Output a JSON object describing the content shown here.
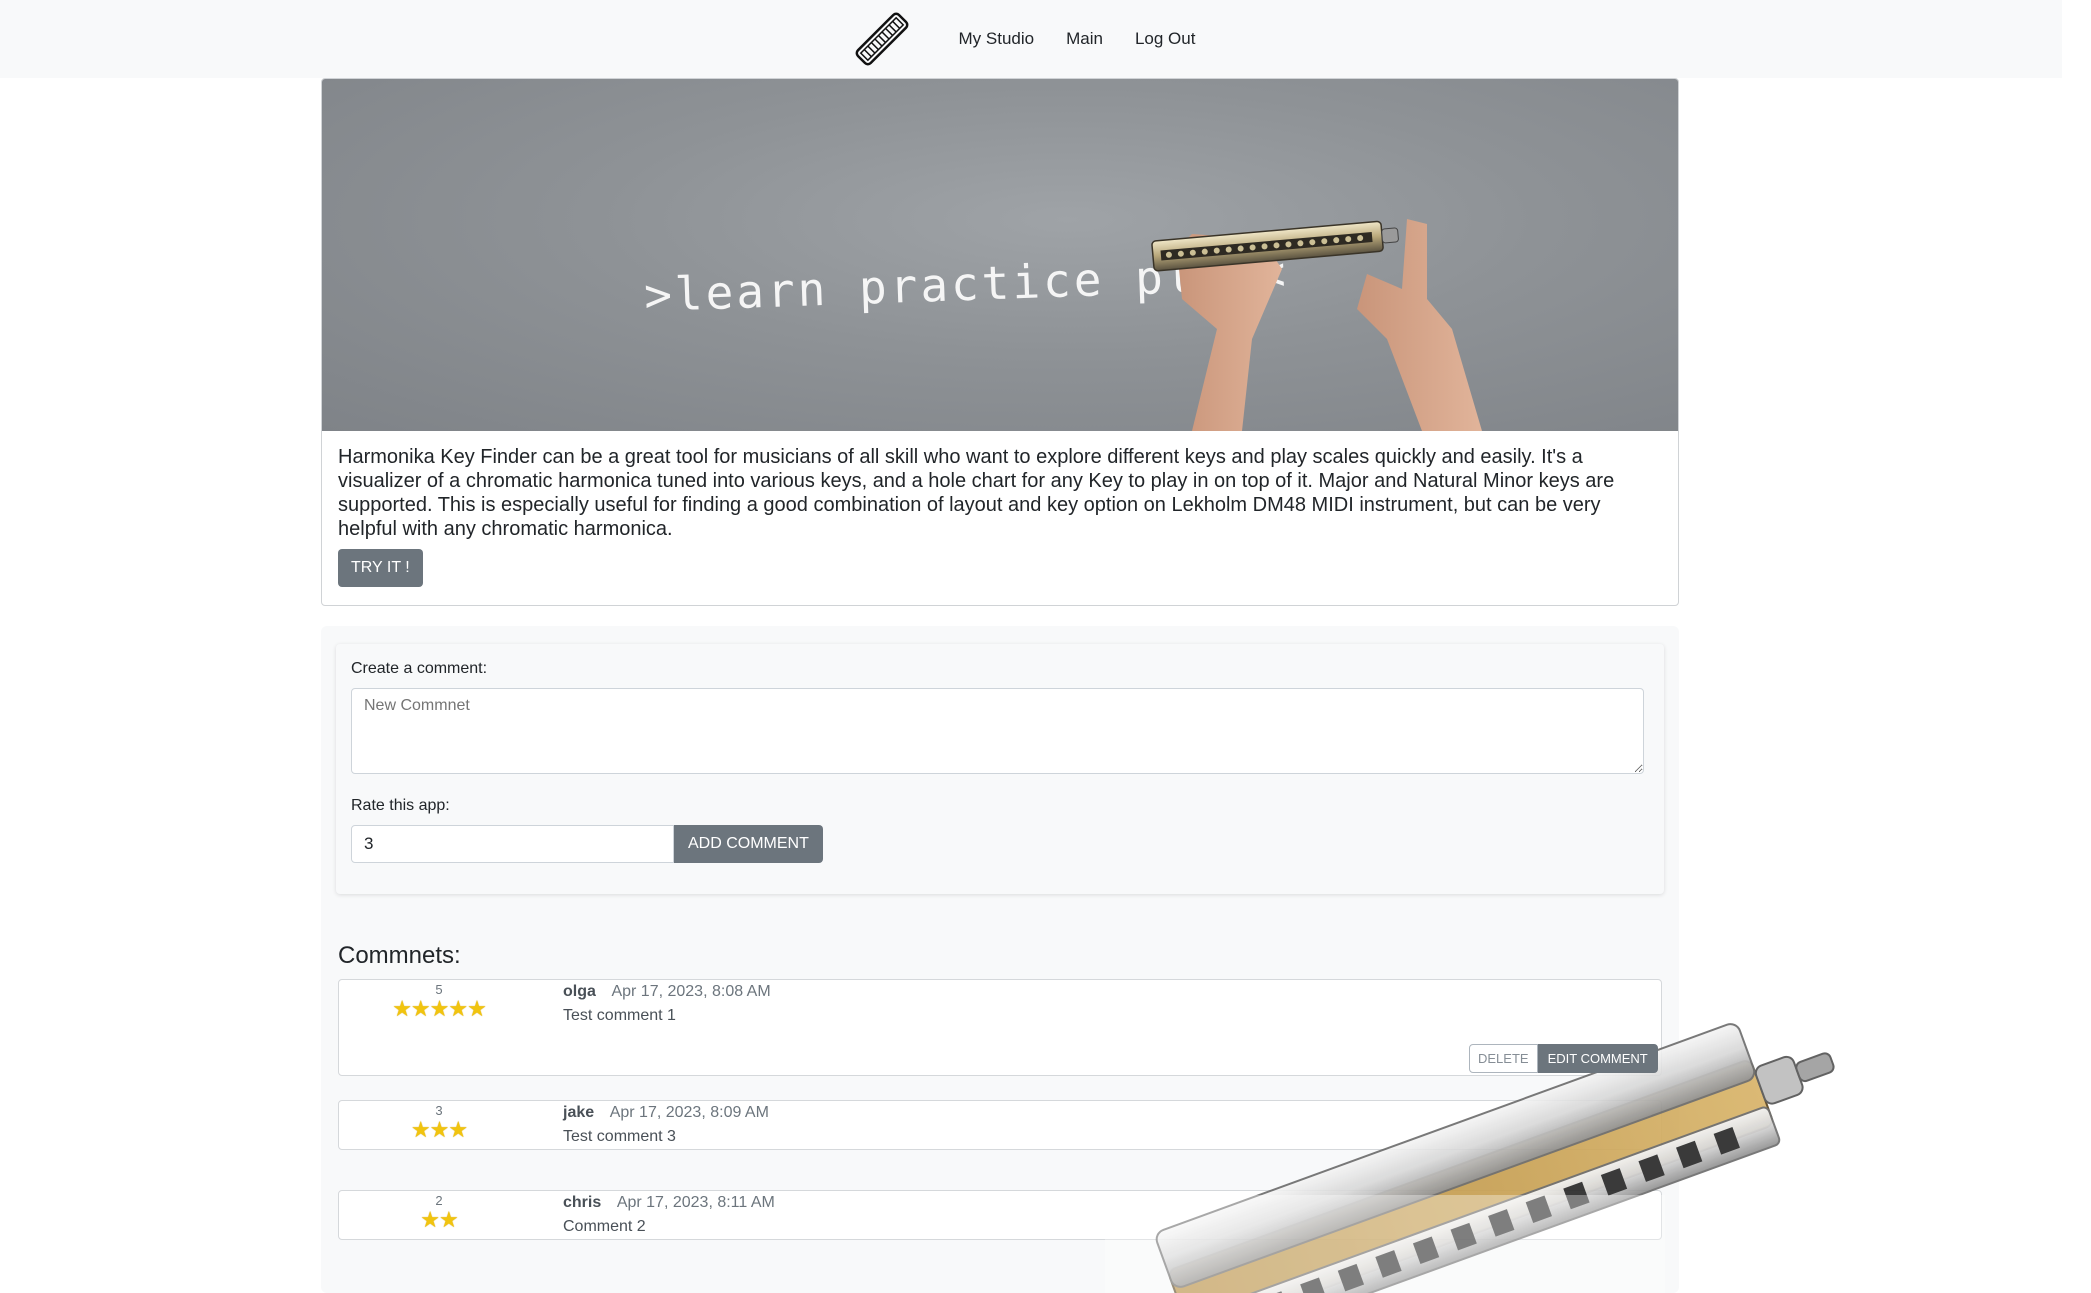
{
  "nav": {
    "logo_name": "harmonica-logo",
    "links": [
      "My Studio",
      "Main",
      "Log Out"
    ]
  },
  "hero": {
    "tagline": ">learn practice play<"
  },
  "description": "Harmonika Key Finder can be a great tool for musicians of all skill who want to explore different keys and play scales quickly and easily. It's a visualizer of a chromatic harmonica tuned into various keys, and a hole chart for any Key to play in on top of it. Major and Natural Minor keys are supported. This is especially useful for finding a good combination of layout and key option on Lekholm DM48 MIDI instrument, but can be very helpful with any chromatic harmonica.",
  "try_button": "TRY IT !",
  "form": {
    "comment_label": "Create a comment:",
    "comment_placeholder": "New Commnet",
    "rate_label": "Rate this app:",
    "rate_value": "3",
    "add_button": "ADD COMMENT"
  },
  "comments_title": "Commnets:",
  "comments": [
    {
      "rating": "5",
      "stars": "★★★★★",
      "user": "olga",
      "date": "Apr 17, 2023, 8:08 AM",
      "text": "Test comment 1",
      "delete": "DELETE",
      "edit": "EDIT COMMENT"
    },
    {
      "rating": "3",
      "stars": "★★★",
      "user": "jake",
      "date": "Apr 17, 2023, 8:09 AM",
      "text": "Test comment 3"
    },
    {
      "rating": "2",
      "stars": "★★",
      "user": "chris",
      "date": "Apr 17, 2023, 8:11 AM",
      "text": "Comment 2"
    }
  ],
  "colors": {
    "navbar_bg": "#f8f9fa",
    "button_bg": "#6c757d",
    "star": "#f1c40f"
  }
}
